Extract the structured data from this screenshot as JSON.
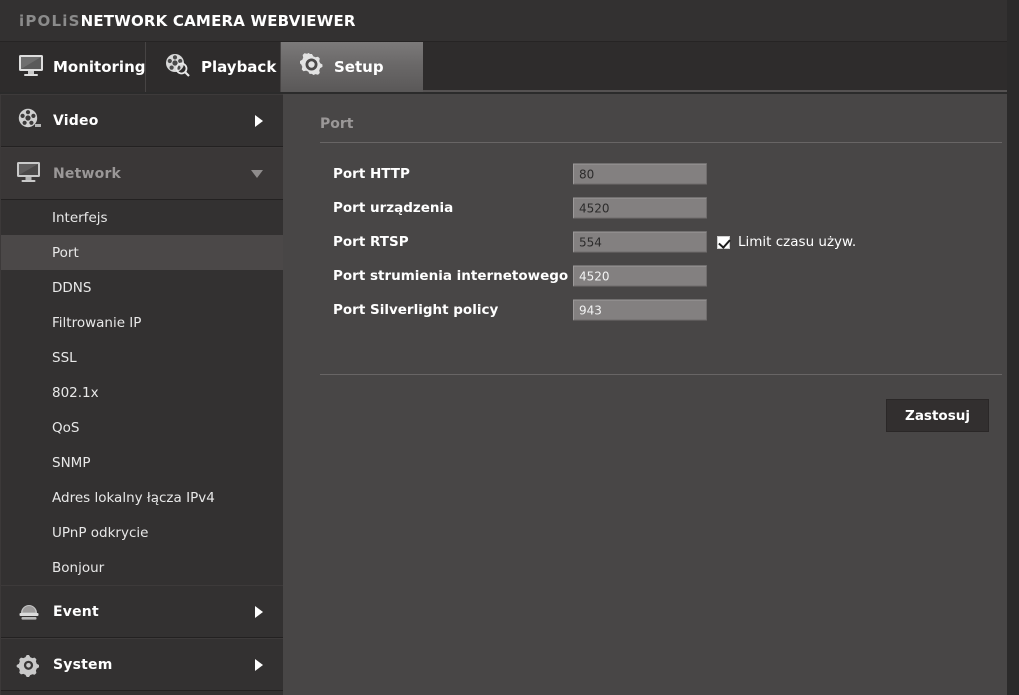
{
  "header": {
    "brand": "iPOLiS",
    "product": "NETWORK CAMERA WEBVIEWER"
  },
  "tabs": [
    {
      "id": "monitoring",
      "label": "Monitoring",
      "icon": "monitor-icon",
      "active": false
    },
    {
      "id": "playback",
      "label": "Playback",
      "icon": "film-reel-search-icon",
      "active": false
    },
    {
      "id": "setup",
      "label": "Setup",
      "icon": "gear-icon",
      "active": true
    }
  ],
  "sidebar": {
    "groups": [
      {
        "id": "video",
        "label": "Video",
        "icon": "film-reel-icon",
        "state": "collapsed",
        "arrow": "right"
      },
      {
        "id": "network",
        "label": "Network",
        "icon": "monitor-icon",
        "state": "expanded",
        "arrow": "down"
      },
      {
        "id": "event",
        "label": "Event",
        "icon": "alarm-dome-icon",
        "state": "collapsed",
        "arrow": "right"
      },
      {
        "id": "system",
        "label": "System",
        "icon": "gear-icon",
        "state": "collapsed",
        "arrow": "right"
      }
    ],
    "network_items": [
      {
        "id": "interfejs",
        "label": "Interfejs",
        "active": false
      },
      {
        "id": "port",
        "label": "Port",
        "active": true
      },
      {
        "id": "ddns",
        "label": "DDNS",
        "active": false
      },
      {
        "id": "ip-filter",
        "label": "Filtrowanie IP",
        "active": false
      },
      {
        "id": "ssl",
        "label": "SSL",
        "active": false
      },
      {
        "id": "8021x",
        "label": "802.1x",
        "active": false
      },
      {
        "id": "qos",
        "label": "QoS",
        "active": false
      },
      {
        "id": "snmp",
        "label": "SNMP",
        "active": false
      },
      {
        "id": "ipv4-local",
        "label": "Adres lokalny łącza IPv4",
        "active": false
      },
      {
        "id": "upnp",
        "label": "UPnP odkrycie",
        "active": false
      },
      {
        "id": "bonjour",
        "label": "Bonjour",
        "active": false
      }
    ]
  },
  "main": {
    "panel_title": "Port",
    "fields": [
      {
        "id": "http",
        "label": "Port HTTP",
        "value": "80",
        "dim": false
      },
      {
        "id": "device",
        "label": "Port urządzenia",
        "value": "4520",
        "dim": false
      },
      {
        "id": "rtsp",
        "label": "Port RTSP",
        "value": "554",
        "dim": false
      },
      {
        "id": "webstream",
        "label": "Port strumienia internetowego",
        "value": "4520",
        "dim": true
      },
      {
        "id": "silverlight",
        "label": "Port Silverlight policy",
        "value": "943",
        "dim": true
      }
    ],
    "timeout_checkbox": {
      "label": "Limit czasu używ.",
      "checked": true
    },
    "apply_label": "Zastosuj"
  },
  "colors": {
    "header_bg": "#333131",
    "sidebar_bg": "#333131",
    "sidebar_active": "#4b4848",
    "main_bg": "#484646",
    "input_bg": "#838080",
    "tab_active": "#6a6868",
    "apply_bg": "#322f2f",
    "text_white": "#ffffff",
    "text_muted": "#9b9898"
  }
}
